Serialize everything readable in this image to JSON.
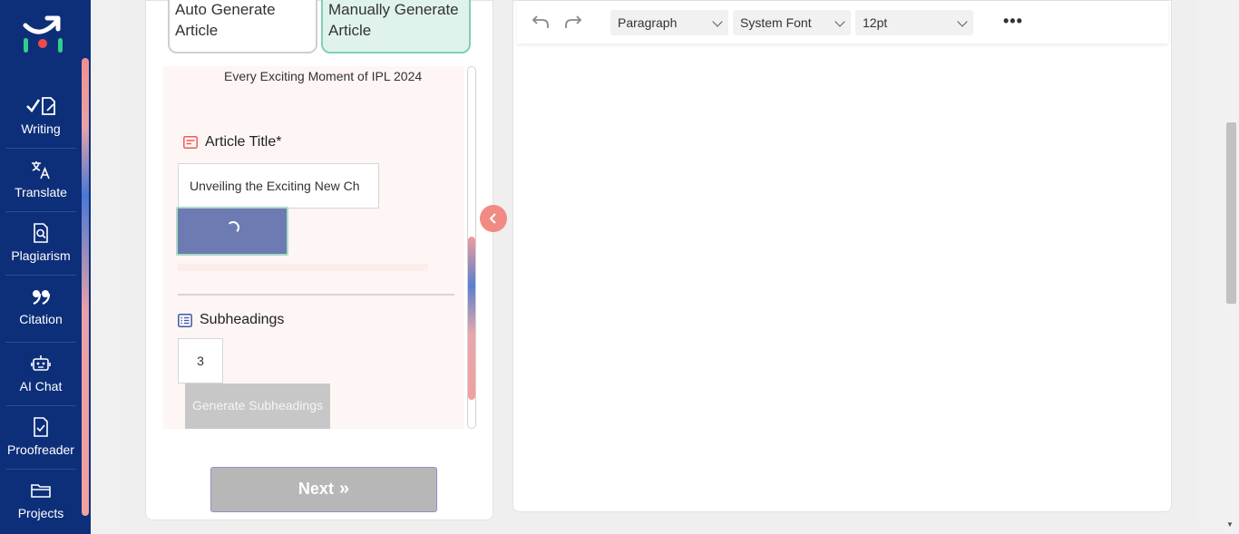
{
  "sidebar": {
    "items": [
      {
        "label": "Writing",
        "icon": "writing-check-icon"
      },
      {
        "label": "Translate",
        "icon": "translate-icon"
      },
      {
        "label": "Plagiarism",
        "icon": "plagiarism-search-icon"
      },
      {
        "label": "Citation",
        "icon": "quote-icon"
      },
      {
        "label": "AI Chat",
        "icon": "robot-icon"
      },
      {
        "label": "Proofreader",
        "icon": "document-check-icon"
      },
      {
        "label": "Projects",
        "icon": "folder-icon"
      }
    ]
  },
  "modes": {
    "auto_label": "Auto Generate Article",
    "manual_label": "Manually Generate Article"
  },
  "form": {
    "topic_text": "Every Exciting Moment of IPL 2024",
    "title_label": "Article Title*",
    "title_value": "Unveiling the Exciting New Ch",
    "subheadings_label": "Subheadings",
    "subheadings_count": "3",
    "generate_subheadings_label": "Generate Subheadings",
    "next_label": "Next",
    "next_chevron": "»"
  },
  "editor": {
    "block_format": "Paragraph",
    "font_family": "System Font",
    "font_size": "12pt",
    "more_label": "•••"
  },
  "colors": {
    "sidebar_bg": "#0d2f7a",
    "accent_teal": "#7fd0b6",
    "accent_coral": "#f28a84",
    "generate_button": "#6e7bb2"
  }
}
